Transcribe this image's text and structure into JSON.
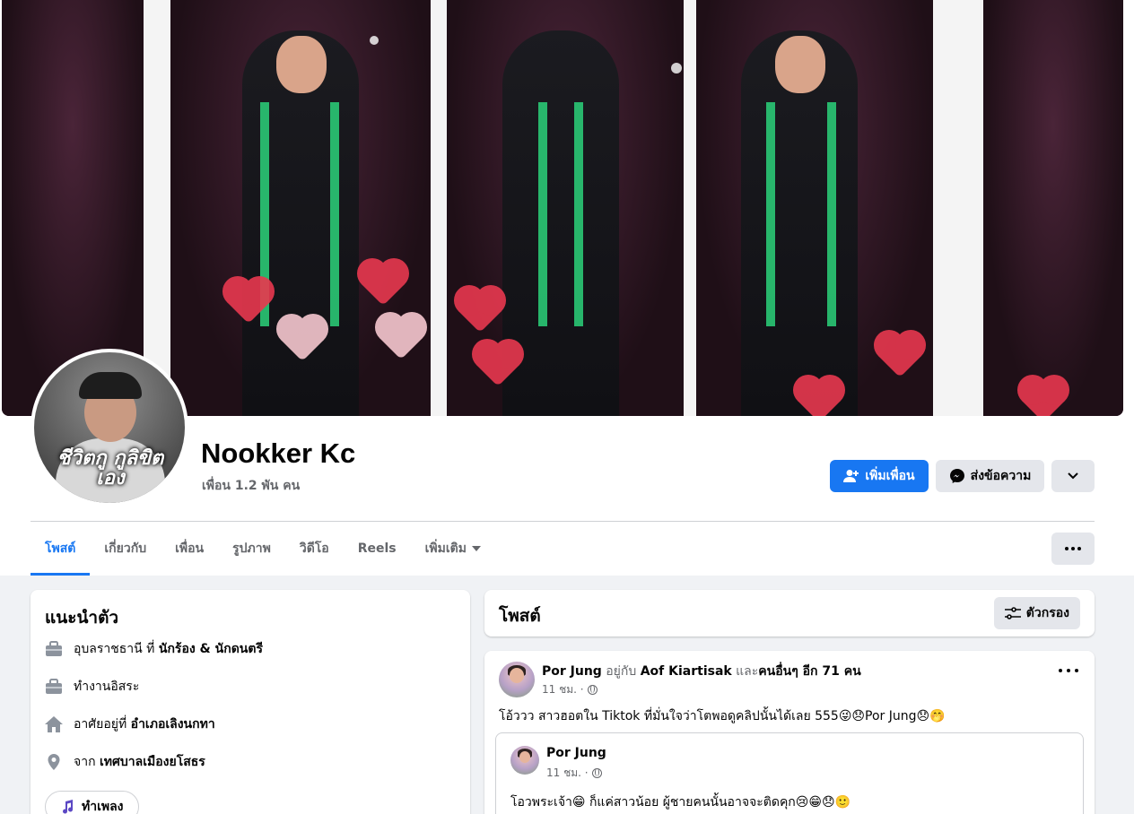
{
  "profile": {
    "name": "Nookker Kc",
    "friends": "เพื่อน 1.2 พัน คน",
    "avatar_caption": "ชีวิตกู กูลิขิตเอง"
  },
  "actions": {
    "add_friend": "เพิ่มเพื่อน",
    "message": "ส่งข้อความ"
  },
  "tabs": [
    {
      "label": "โพสต์"
    },
    {
      "label": "เกี่ยวกับ"
    },
    {
      "label": "เพื่อน"
    },
    {
      "label": "รูปภาพ"
    },
    {
      "label": "วิดีโอ"
    },
    {
      "label": "Reels"
    },
    {
      "label": "เพิ่มเติม"
    }
  ],
  "intro": {
    "title": "แนะนำตัว",
    "items": [
      {
        "icon": "briefcase-icon",
        "prefix": "อุบลราชธานี ที่ ",
        "bold": "นักร้อง & นักดนตรี"
      },
      {
        "icon": "briefcase-icon",
        "prefix": "ทำงานอิสระ",
        "bold": ""
      },
      {
        "icon": "home-icon",
        "prefix": "อาศัยอยู่ที่ ",
        "bold": "อำเภอเลิงนกทา"
      },
      {
        "icon": "location-pin-icon",
        "prefix": "จาก ",
        "bold": "เทศบาลเมืองยโสธร"
      }
    ],
    "music_label": "ทำเพลง"
  },
  "posts_section": {
    "title": "โพสต์",
    "filter_label": "ตัวกรอง"
  },
  "post": {
    "author": "Por Jung",
    "with_text": " อยู่กับ ",
    "tagged": "Aof Kiartisak",
    "and_text": " และ",
    "others": "คนอื่นๆ อีก 71 คน",
    "time": "11 ชม. ·",
    "text": "โอ้ววว สาวฮอตใน Tiktok ที่มั่นใจว่าโตพอดูคลิปนั้นได้เลย 555😜😞Por Jung😞🤭",
    "shared": {
      "author": "Por Jung",
      "time": "11 ชม. ·",
      "text": "โอวพระเจ้า😁 ก็แค่สาวน้อย ผู้ชายคนนั้นอาจจะติดคุก😢😁😞🙂"
    }
  },
  "colors": {
    "accent": "#1877f2",
    "page_bg": "#f0f2f5",
    "button_gray": "#e4e6eb",
    "muted_text": "#65676b"
  }
}
